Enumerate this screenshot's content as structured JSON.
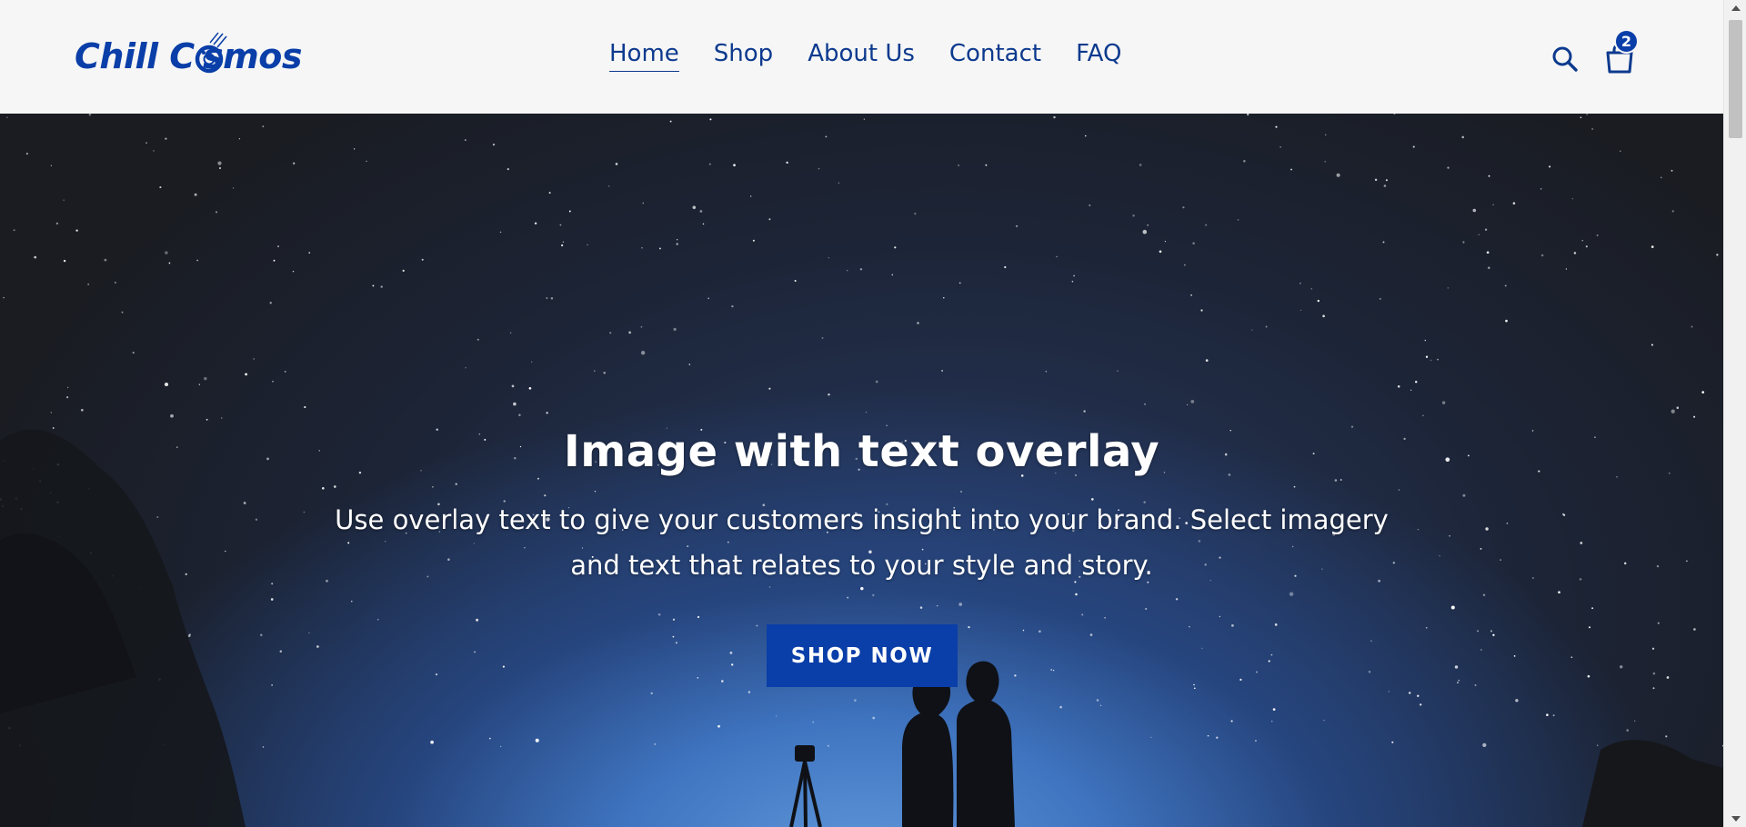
{
  "brand": {
    "logo_text_before": "Chill C",
    "logo_text_after": "smos",
    "color": "#0a3ea8"
  },
  "nav": {
    "items": [
      {
        "label": "Home",
        "active": true
      },
      {
        "label": "Shop",
        "active": false
      },
      {
        "label": "About Us",
        "active": false
      },
      {
        "label": "Contact",
        "active": false
      },
      {
        "label": "FAQ",
        "active": false
      }
    ]
  },
  "header_actions": {
    "search_icon": "search-icon",
    "cart_icon": "shopping-bag-icon",
    "cart_count": "2"
  },
  "hero": {
    "title": "Image with text overlay",
    "text": "Use overlay text to give your customers insight into your brand. Select imagery and text that relates to your style and story.",
    "button_label": "SHOP NOW",
    "button_color": "#0a3ea8"
  },
  "colors": {
    "header_bg": "#f6f6f6",
    "nav_text": "#0d3a8e",
    "accent": "#0a3ea8"
  }
}
